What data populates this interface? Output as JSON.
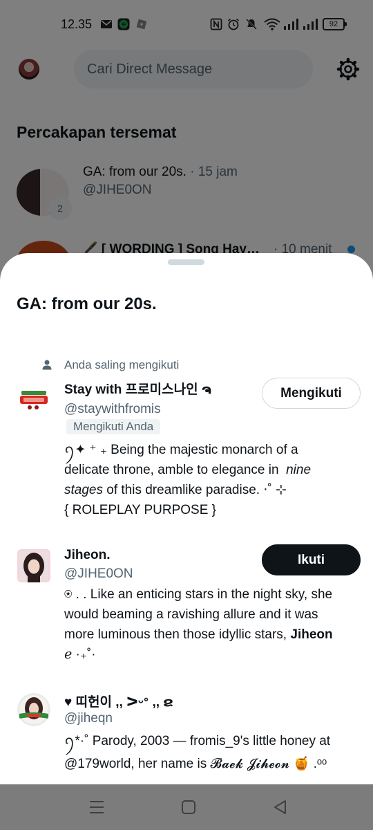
{
  "status_bar": {
    "time": "12.35",
    "battery": "92"
  },
  "search": {
    "placeholder": "Cari Direct Message"
  },
  "pinned": {
    "title": "Percakapan tersemat",
    "conversations": [
      {
        "title": "GA: from our 20s.",
        "time": "· 15 jam",
        "handle": "@JIHE0ON",
        "badge": "2"
      },
      {
        "title": "🖋️ [ WORDING ] Song Hay…",
        "time": "· 10 menit"
      }
    ]
  },
  "sheet": {
    "title": "GA: from our 20s.",
    "mutual_label": "Anda saling mengikuti",
    "members": [
      {
        "name": "Stay with 프로미스나인 ຈ",
        "handle": "@staywithfromis",
        "follows_you": "Mengikuti Anda",
        "button": "Mengikuti",
        "bio_line1": "ꪆ✦ ⁺ ₊ Being the majestic monarch of a",
        "bio_line2_a": "delicate throne, amble to elegance in",
        "bio_line2_b": "nine",
        "bio_line3_a": "stages",
        "bio_line3_b": "of this dreamlike paradise. ‧˚ ⊹",
        "bio_line4": "{ ROLEPLAY PURPOSE }"
      },
      {
        "name": "Jiheon.",
        "handle": "@JIHE0ON",
        "button": "Ikuti",
        "bio_line1": "⍟ . . Like an enticing stars in the night sky, she",
        "bio_line2": "would beaming a ravishing allure and it was",
        "bio_line3_a": "more luminous then those idyllic stars,",
        "bio_line3_b": "Jiheon",
        "bio_line4": "ℯ ·₊˚·"
      },
      {
        "name": "♥ 띠헌이 ,, ᐳᵕᐤ ,, ຂ",
        "handle": "@jiheqn",
        "bio_line1": "ꪆ*·˚ Parody, 2003 — fromis_9's little honey at",
        "bio_line2": "@179world,  her  name  is  𝓑𝓪𝓮𝓴 𝓙𝓲𝓱𝓮𝓸𝓷 🍯 .ᵒᵒ"
      }
    ]
  },
  "colors": {
    "accent": "#1d9bf0",
    "text_primary": "#0f1419",
    "text_secondary": "#536471"
  },
  "icons": [
    "mail-icon",
    "spotify-icon",
    "roblox-icon",
    "nfc-icon",
    "alarm-icon",
    "mute-icon",
    "wifi-icon",
    "signal-icon",
    "battery-icon",
    "gear-icon",
    "person-icon",
    "menu-icon",
    "home-icon",
    "back-icon"
  ]
}
